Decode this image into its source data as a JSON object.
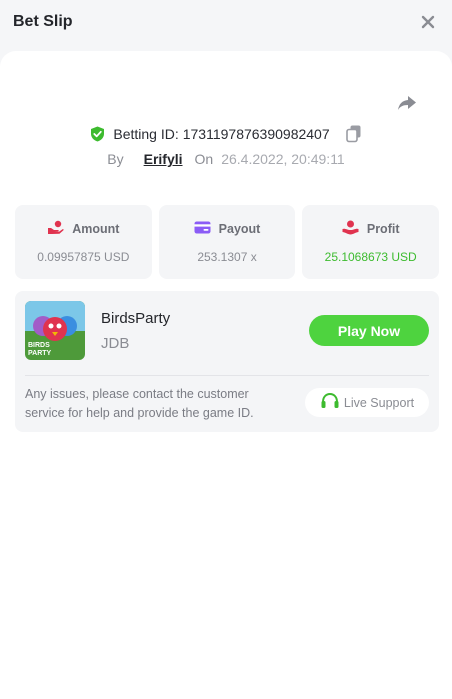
{
  "header": {
    "title": "Bet Slip"
  },
  "bet": {
    "id_label": "Betting ID:",
    "id_value": "1731197876390982407",
    "by_label": "By",
    "user": "Erifyli",
    "on_label": "On",
    "date": "26.4.2022, 20:49:11"
  },
  "stats": {
    "amount": {
      "label": "Amount",
      "value": "0.09957875 USD"
    },
    "payout": {
      "label": "Payout",
      "value": "253.1307 x"
    },
    "profit": {
      "label": "Profit",
      "value": "25.1068673 USD"
    }
  },
  "game": {
    "name": "BirdsParty",
    "provider": "JDB",
    "thumb_text": "BIRDS PARTY",
    "play_label": "Play Now",
    "help_text": "Any issues, please contact the customer service for help and provide the game ID.",
    "support_label": "Live Support"
  },
  "colors": {
    "accent_green": "#4ed33f",
    "profit_green": "#3dbb2f",
    "icon_red": "#e0334f",
    "icon_purple": "#8b5cf6"
  },
  "icons": [
    "close-icon",
    "share-icon",
    "shield-check-icon",
    "copy-icon",
    "amount-icon",
    "payout-card-icon",
    "profit-hand-icon",
    "headset-icon"
  ]
}
